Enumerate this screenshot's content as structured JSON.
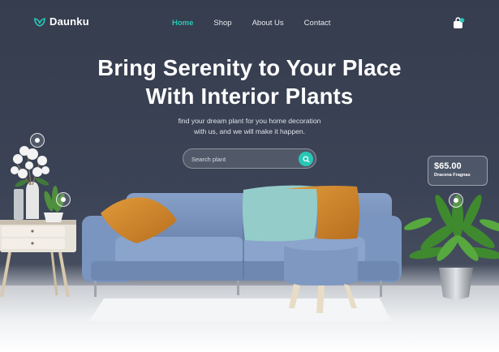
{
  "brand": {
    "name": "Daunku"
  },
  "nav": {
    "items": [
      {
        "label": "Home",
        "active": true
      },
      {
        "label": "Shop",
        "active": false
      },
      {
        "label": "About Us",
        "active": false
      },
      {
        "label": "Contact",
        "active": false
      }
    ],
    "cart_icon": "shopping-bag-icon"
  },
  "hero": {
    "title_line1": "Bring Serenity to Your Place",
    "title_line2": "With Interior Plants",
    "subtitle_line1": "find your dream plant for you home decoration",
    "subtitle_line2": "with us, and we will make it happen."
  },
  "search": {
    "placeholder": "Search plant",
    "icon": "search-icon"
  },
  "product_card": {
    "price": "$65.00",
    "name": "Dracena Fragnas"
  },
  "colors": {
    "accent": "#28c7b5",
    "wall": "#3b4356",
    "sofa": "#7f9ac4",
    "pillow_orange": "#d18a2c",
    "pillow_teal": "#8ecbc9"
  }
}
